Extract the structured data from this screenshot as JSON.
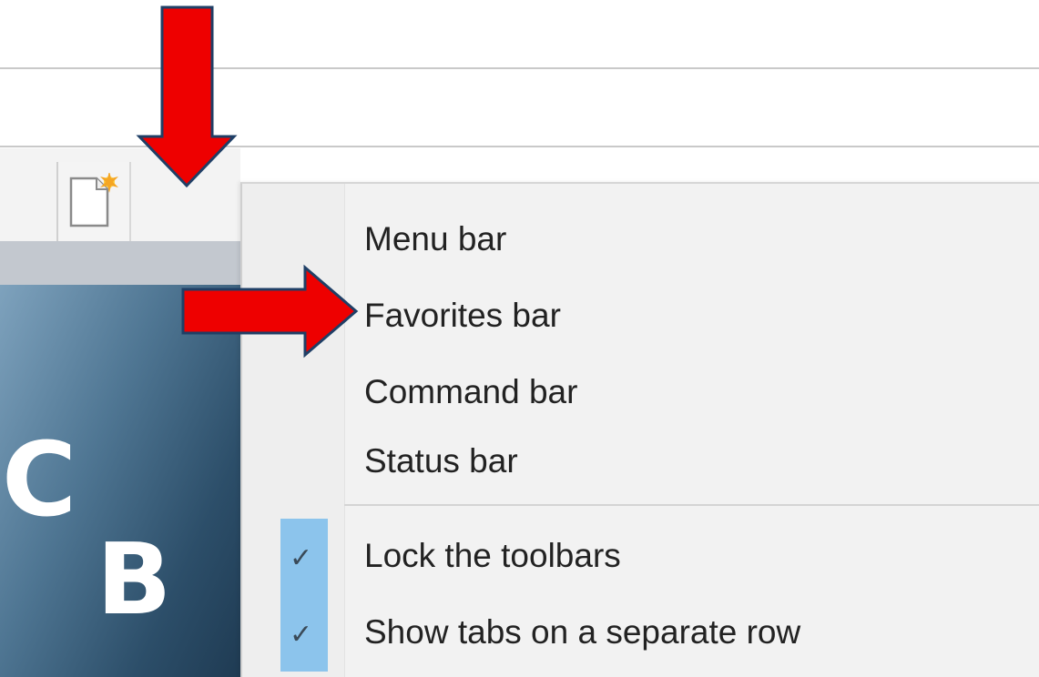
{
  "menu": {
    "items": [
      {
        "label": "Menu bar",
        "checked": false
      },
      {
        "label": "Favorites bar",
        "checked": false
      },
      {
        "label": "Command bar",
        "checked": false
      },
      {
        "label": "Status bar",
        "checked": false
      },
      {
        "label": "Lock the toolbars",
        "checked": true
      },
      {
        "label": "Show tabs on a separate row",
        "checked": true
      }
    ]
  },
  "site_logo": {
    "letter_1": "C",
    "letter_2": "B"
  },
  "icons": {
    "new_tab": "new-tab-icon",
    "checkmark": "checkmark-icon",
    "arrow": "red-arrow"
  },
  "colors": {
    "arrow_fill": "#ee0000",
    "arrow_outline": "#1f3f66",
    "check_highlight": "#8cc4ec",
    "menu_bg": "#f2f2f2"
  }
}
